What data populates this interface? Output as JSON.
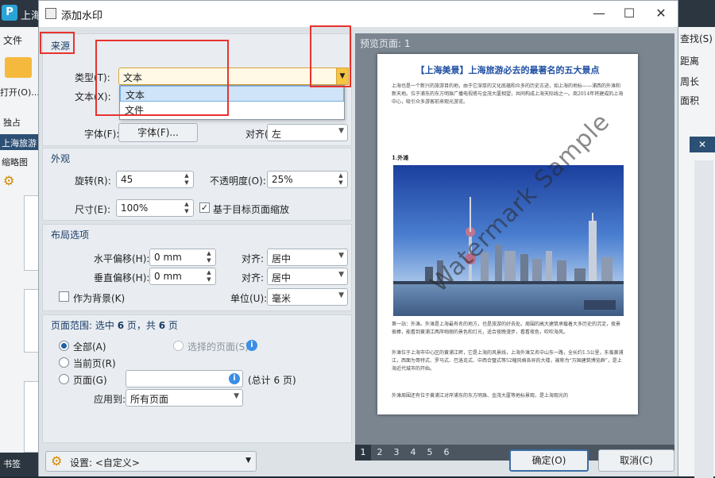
{
  "background_app": {
    "title": "上海",
    "menu_file": "文件",
    "open_label": "打开(O)...",
    "solo_label": "独占",
    "tab_label": "上海旅游",
    "thumbnail_label": "缩略图",
    "bookmark_label": "书签",
    "right_items": [
      "查找(S)",
      "距离",
      "周长",
      "面积"
    ]
  },
  "dialog": {
    "title": "添加水印",
    "min_symbol": "—",
    "max_symbol": "☐",
    "close_symbol": "✕"
  },
  "source": {
    "group_title": "来源",
    "type_label": "类型(T):",
    "type_value": "文本",
    "type_options": [
      "文本",
      "文件"
    ],
    "text_label": "文本(X):",
    "font_label": "字体(F):",
    "font_button": "字体(F)...",
    "align_label": "对齐(L):",
    "align_value": "左"
  },
  "appearance": {
    "group_title": "外观",
    "rotation_label": "旋转(R):",
    "rotation_value": "45",
    "opacity_label": "不透明度(O):",
    "opacity_value": "25%",
    "size_label": "尺寸(E):",
    "size_value": "100%",
    "scale_checkbox_label": "基于目标页面缩放",
    "scale_checked": true
  },
  "layout": {
    "group_title": "布局选项",
    "h_offset_label": "水平偏移(H):",
    "h_offset_value": "0 mm",
    "h_align_label": "对齐:",
    "h_align_value": "居中",
    "v_offset_label": "垂直偏移(H):",
    "v_offset_value": "0 mm",
    "v_align_label": "对齐:",
    "v_align_value": "居中",
    "background_label": "作为背景(K)",
    "background_checked": false,
    "unit_label": "单位(U):",
    "unit_value": "毫米"
  },
  "page_range": {
    "title_prefix": "页面范围: 选中",
    "selected_count": "6",
    "title_mid": "页，共",
    "total_count": "6",
    "title_suffix": "页",
    "all_label": "全部(A)",
    "selected_pages_label": "选择的页面(S)",
    "current_label": "当前页(R)",
    "pages_label": "页面(G)",
    "total_note": "(总计 6 页)",
    "apply_label": "应用到:",
    "apply_value": "所有页面",
    "selected_option": "all"
  },
  "footer": {
    "settings_label": "设置: <自定义>",
    "ok_label": "确定(O)",
    "cancel_label": "取消(C)"
  },
  "preview": {
    "title": "预览页面: 1",
    "doc_title": "【上海美景】上海旅游必去的最著名的五大景点",
    "para1": "上海也是一个新兴的旅游目的地，由于它深厚的文化底蕴和众多的历史古迹，如上海的地标——浦西的外滩和新天地。位于浦东的东方明珠广播电视塔与金茂大厦相望，共同构成上海天际线之一。商2014年将建成的上海中心，吸引众多游客前来观光游览。",
    "section1": "1.外滩",
    "para2": "第一站：外滩。外滩是上海最有名的地方，也是旅游的好去处。周围的高大建筑承载着大多历史的沉淀，夜景很棒，能看到黄浦江两岸绚丽的景色和灯光，适合夜晚漫步，看看夜色，吹吹海风。",
    "para3": "外滩位于上海市中心区的黄浦江畔，它是上海的风景线，上海外滩又名中山东一路，全长约1.5公里，东临黄浦江，西面为哥特式、罗马式、巴洛克式、中西合璧式等52幢风格各异的大楼，被称为“万国建筑博览群”，是上海近代城市的开始。",
    "para4": "外滩周围还有位于黄浦江对岸浦东的东方明珠、金茂大厦等地标景观，是上海观光的",
    "watermark_text": "Watermark Sample",
    "pages": [
      "1",
      "2",
      "3",
      "4",
      "5",
      "6"
    ],
    "active_page": "1"
  },
  "colors": {
    "accent": "#1e5fa8",
    "highlight_red": "#e8322e",
    "dialog_bg": "#dde2e7",
    "preview_bg": "#7a8590"
  }
}
